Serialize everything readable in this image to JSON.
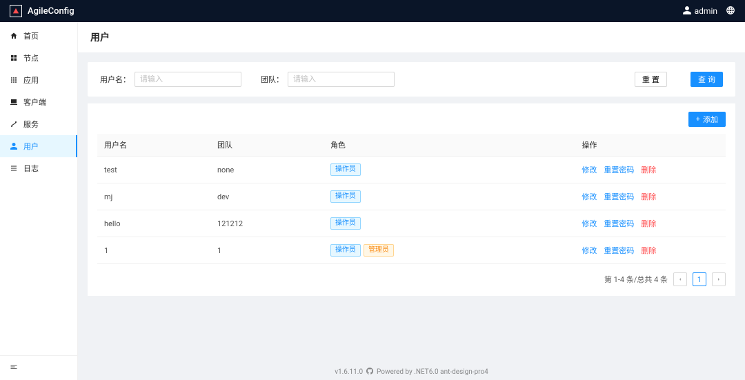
{
  "brand": "AgileConfig",
  "header": {
    "username": "admin"
  },
  "sidebar": {
    "items": [
      {
        "key": "home",
        "label": "首页"
      },
      {
        "key": "node",
        "label": "节点"
      },
      {
        "key": "app",
        "label": "应用"
      },
      {
        "key": "client",
        "label": "客户端"
      },
      {
        "key": "service",
        "label": "服务"
      },
      {
        "key": "user",
        "label": "用户"
      },
      {
        "key": "log",
        "label": "日志"
      }
    ],
    "active_key": "user"
  },
  "page": {
    "title": "用户"
  },
  "filter": {
    "username_label": "用户名：",
    "team_label": "团队：",
    "placeholder": "请输入",
    "reset_label": "重 置",
    "search_label": "查 询"
  },
  "toolbar": {
    "add_label": "添加"
  },
  "table": {
    "columns": {
      "username": "用户名",
      "team": "团队",
      "role": "角色",
      "actions": "操作"
    },
    "role_labels": {
      "operator": "操作员",
      "admin": "管理员"
    },
    "action_labels": {
      "edit": "修改",
      "reset_pw": "重置密码",
      "delete": "删除"
    },
    "rows": [
      {
        "username": "test",
        "team": "none",
        "roles": [
          "operator"
        ]
      },
      {
        "username": "mj",
        "team": "dev",
        "roles": [
          "operator"
        ]
      },
      {
        "username": "hello",
        "team": "121212",
        "roles": [
          "operator"
        ]
      },
      {
        "username": "1",
        "team": "1",
        "roles": [
          "operator",
          "admin"
        ]
      }
    ]
  },
  "pagination": {
    "summary": "第 1-4 条/总共 4 条",
    "current": "1"
  },
  "footer": {
    "version": "v1.6.11.0",
    "powered": "Powered by .NET6.0 ant-design-pro4"
  }
}
